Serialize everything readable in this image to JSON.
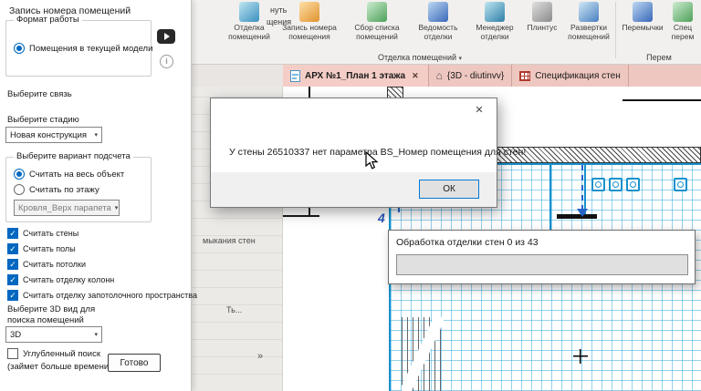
{
  "icons": {
    "close": "✕",
    "chevron_down": "▾",
    "check": "✓",
    "info": "i",
    "home": "⌂"
  },
  "panel": {
    "title": "Запись номера помещений",
    "format_group": {
      "label": "Формат работы",
      "radio": "Помещения в текущей модели"
    },
    "link_label": "Выберите связь",
    "stage_label": "Выберите стадию",
    "stage_value": "Новая конструкция",
    "count_group": {
      "label": "Выберите вариант подсчета",
      "radio_all": "Считать на весь объект",
      "radio_floor": "Считать по этажу",
      "floor_value": "Кровля_Верх парапета"
    },
    "checkboxes": [
      "Считать стены",
      "Считать полы",
      "Считать потолки",
      "Считать отделку колонн",
      "Считать отделку запотолочного пространства"
    ],
    "view3d_label": "Выберите 3D вид для поиска помещений",
    "view3d_value": "3D",
    "deep_search_label": "Углубленный поиск",
    "deep_search_note": "(займет больше времени)",
    "done_button": "Готово"
  },
  "ribbon": {
    "partial": [
      "нуть",
      "щения"
    ],
    "buttons": [
      "Отделка помещений",
      "Запись номера помещения",
      "Сбор списка помещений",
      "Ведомость отделки",
      "Менеджер отделки",
      "Плинтус",
      "Развертки помещений",
      "Перемычки",
      "Спец перем"
    ],
    "group_label_1": "Отделка помещений",
    "group_label_2": "Перем"
  },
  "tabs": [
    {
      "icon": "document-plan",
      "label": "АРХ №1_План 1 этажа"
    },
    {
      "icon": "home-3d",
      "label": "{3D - diutinvv}"
    },
    {
      "icon": "schedule-table",
      "label": "Спецификация стен"
    }
  ],
  "palette": {
    "fragments": [
      "мыкания стен",
      "Ть...",
      "»"
    ]
  },
  "drawing": {
    "grid_label": "4"
  },
  "modal": {
    "message": "У стены 26510337 нет параметра BS_Номер помещения для стен!",
    "ok_label": "ОК"
  },
  "progress": {
    "text": "Обработка отделки стен 0 из 43"
  }
}
